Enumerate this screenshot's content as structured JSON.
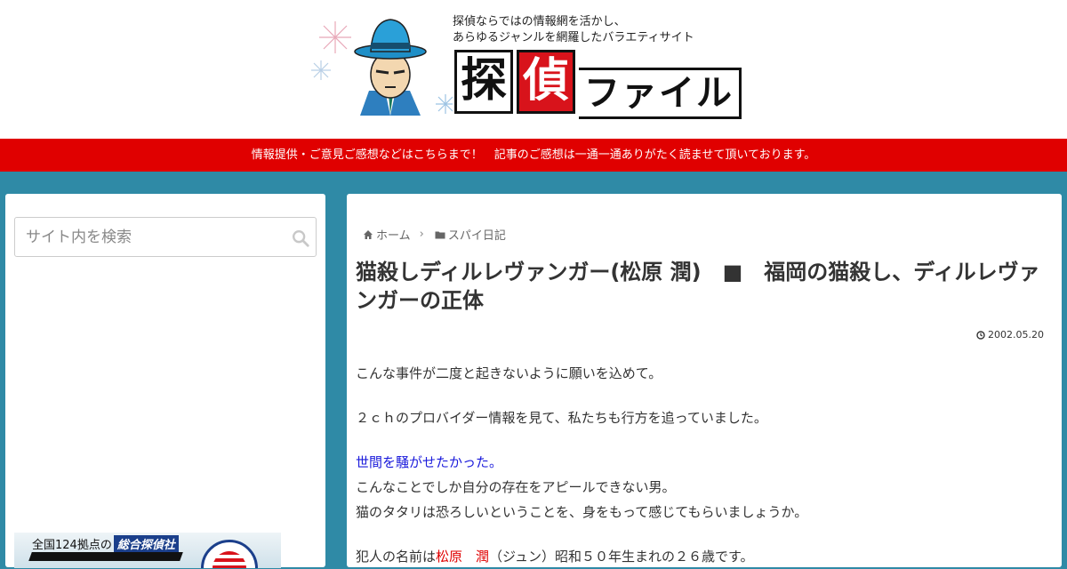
{
  "header": {
    "tagline_line1": "探偵ならではの情報網を活かし、",
    "tagline_line2": "あらゆるジャンルを網羅したバラエティサイト",
    "brand_kanji_1": "探",
    "brand_kanji_2": "偵",
    "brand_kana": "ファイル"
  },
  "notice_bar": {
    "text": "情報提供・ご意見ご感想などはこちらまで！　記事のご感想は一通一通ありがたく読ませて頂いております。"
  },
  "sidebar": {
    "search_placeholder": "サイト内を検索",
    "banner_text": "全国124拠点の",
    "banner_badge": "総合探偵社"
  },
  "breadcrumb": {
    "home": "ホーム",
    "category": "スパイ日記"
  },
  "article": {
    "title": "猫殺しディルレヴァンガー(松原 潤)　■　福岡の猫殺し、ディルレヴァンガーの正体",
    "date": "2002.05.20",
    "p1": "こんな事件が二度と起きないように願いを込めて。",
    "p2": "２ｃｈのプロバイダー情報を見て、私たちも行方を追っていました。",
    "p3_blue": "世間を騒がせたかった。",
    "p4": "こんなことでしか自分の存在をアピールできない男。",
    "p5": "猫のタタリは恐ろしいということを、身をもって感じてもらいましょうか。",
    "p6_before": "犯人の名前は",
    "p6_red": "松原　潤",
    "p6_after": "（ジュン）昭和５０年生まれの２６歳です。"
  },
  "colors": {
    "page_background": "#2f8aa6",
    "notice_red": "#e00000",
    "link_blue": "#1a1adb"
  }
}
